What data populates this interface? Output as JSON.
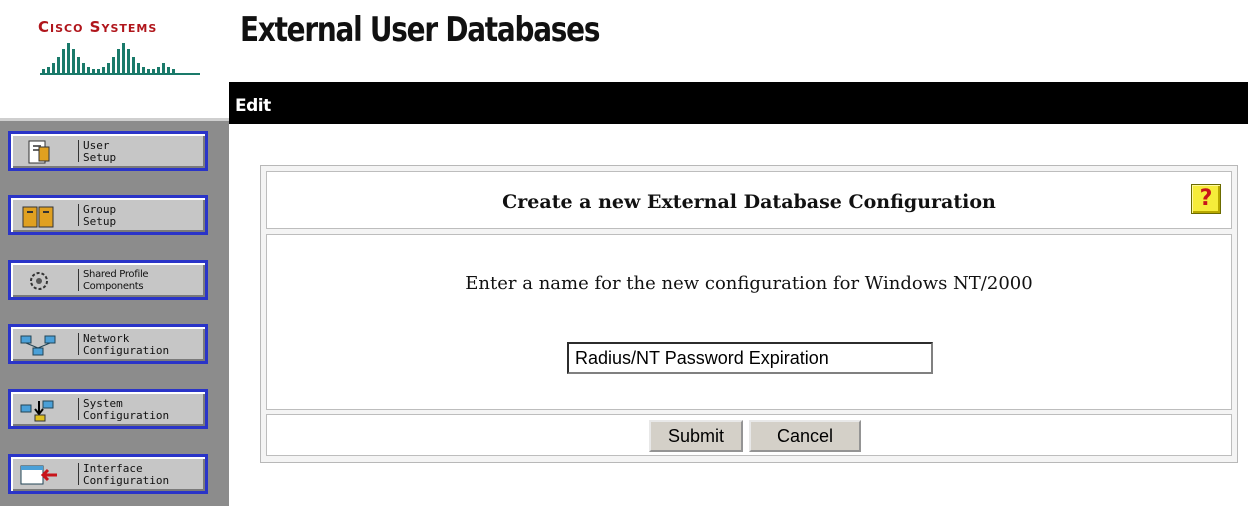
{
  "branding": {
    "logo_text": "Cisco Systems"
  },
  "page_title": "External User Databases",
  "edit_bar": {
    "label": "Edit"
  },
  "nav": {
    "items": [
      {
        "label": "User\nSetup",
        "icon": "user-setup-icon"
      },
      {
        "label": "Group\nSetup",
        "icon": "group-setup-icon"
      },
      {
        "label": "Shared Profile\nComponents",
        "icon": "shared-profile-icon"
      },
      {
        "label": "Network\nConfiguration",
        "icon": "network-config-icon"
      },
      {
        "label": "System\nConfiguration",
        "icon": "system-config-icon"
      },
      {
        "label": "Interface\nConfiguration",
        "icon": "interface-config-icon"
      }
    ]
  },
  "form": {
    "title": "Create a new External Database Configuration",
    "help_label": "?",
    "prompt": "Enter a name for the new configuration for Windows NT/2000",
    "name_value": "Radius/NT Password Expiration",
    "submit_label": "Submit",
    "cancel_label": "Cancel"
  },
  "colors": {
    "logo_red": "#b0151b",
    "nav_border_blue": "#2a34c8",
    "nav_background": "#8c8c8c",
    "help_yellow": "#f6ec3a"
  }
}
